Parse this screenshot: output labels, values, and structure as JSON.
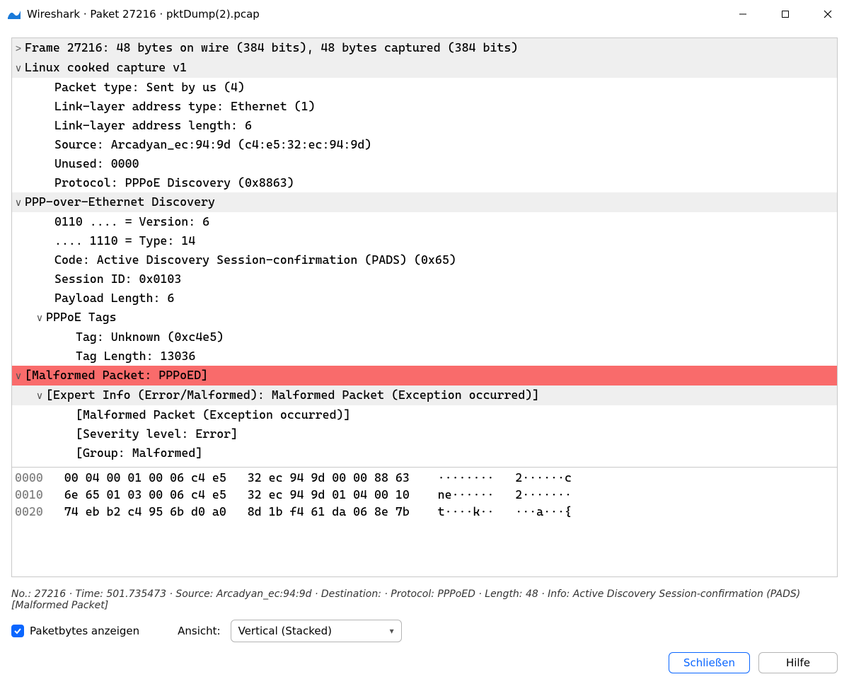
{
  "window": {
    "title": "Wireshark · Paket 27216 · pktDump(2).pcap"
  },
  "tree": {
    "frame": "Frame 27216: 48 bytes on wire (384 bits), 48 bytes captured (384 bits)",
    "sll_header": "Linux cooked capture v1",
    "sll": {
      "packet_type": "Packet type: Sent by us (4)",
      "ll_addr_type": "Link-layer address type: Ethernet (1)",
      "ll_addr_len": "Link-layer address length: 6",
      "source": "Source: Arcadyan_ec:94:9d (c4:e5:32:ec:94:9d)",
      "unused": "Unused: 0000",
      "protocol": "Protocol: PPPoE Discovery (0x8863)"
    },
    "pppoe_header": "PPP-over-Ethernet Discovery",
    "pppoe": {
      "version": "0110 .... = Version: 6",
      "type": ".... 1110 = Type: 14",
      "code": "Code: Active Discovery Session-confirmation (PADS) (0x65)",
      "session_id": "Session ID: 0x0103",
      "payload_len": "Payload Length: 6",
      "tags_header": "PPPoE Tags",
      "tag": "Tag: Unknown (0xc4e5)",
      "tag_len": "Tag Length: 13036"
    },
    "malformed_header": "[Malformed Packet: PPPoED]",
    "expert_header": "[Expert Info (Error/Malformed): Malformed Packet (Exception occurred)]",
    "expert": {
      "msg": "[Malformed Packet (Exception occurred)]",
      "severity": "[Severity level: Error]",
      "group": "[Group: Malformed]"
    }
  },
  "hex": {
    "l0_off": "0000",
    "l0_hex": "00 04 00 01 00 06 c4 e5   32 ec 94 9d 00 00 88 63",
    "l0_asc": "········   2······c",
    "l1_off": "0010",
    "l1_hex": "6e 65 01 03 00 06 c4 e5   32 ec 94 9d 01 04 00 10",
    "l1_asc": "ne······   2·······",
    "l2_off": "0020",
    "l2_hex": "74 eb b2 c4 95 6b d0 a0   8d 1b f4 61 da 06 8e 7b",
    "l2_asc": "t····k··   ···a···{"
  },
  "status": "No.: 27216 · Time: 501.735473 · Source: Arcadyan_ec:94:9d · Destination:  · Protocol: PPPoED · Length: 48 · Info: Active Discovery Session-confirmation (PADS)[Malformed Packet]",
  "controls": {
    "show_bytes_label": "Paketbytes anzeigen",
    "view_label": "Ansicht:",
    "view_value": "Vertical (Stacked)"
  },
  "buttons": {
    "close": "Schließen",
    "help": "Hilfe"
  }
}
